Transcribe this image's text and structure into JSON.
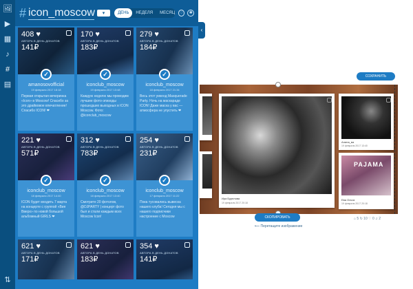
{
  "header": {
    "hash": "#",
    "hashtag": "icon_moscow",
    "dropdown": "▾",
    "periods": [
      "ДЕНЬ",
      "НЕДЕЛЯ",
      "МЕСЯЦ"
    ],
    "active_period": 0
  },
  "rail": [
    "🖼",
    "▶",
    "▦",
    "♪",
    "#",
    "▤",
    "⇅"
  ],
  "cards": [
    {
      "likes": "408 ♥",
      "sub": "АВТОРА В ДЕНЬ ДОНАТОВ",
      "price": "141₽",
      "user": "amanosovofficial",
      "date": "19 февраля 2017 18:18",
      "text": "Первая открытая вечеринка «Icon» в Moscow! Спасибо за это драйвовое впечатление! Спасибо ICON! ❤"
    },
    {
      "likes": "170 ♥",
      "sub": "АВТОРА В ДЕНЬ ДОНАТОВ",
      "price": "183₽",
      "user": "iconclub_moscow",
      "date": "19 февраля 2017 13:48",
      "text": "Каждую неделю мы проводим лучшие фото-эпизоды прошедших выходных в ICON Moscow. Фото: @iconclub_moscow"
    },
    {
      "likes": "279 ♥",
      "sub": "АВТОРА В ДЕНЬ ДОНАТОВ",
      "price": "184₽",
      "user": "iconclub_moscow",
      "date": "18 февраля 2017 21:34",
      "text": "Весь этот уикенд Masquerade Party. Ночь на маскараде ICON! Даже маска у вас — атмосфера не упустить ❤"
    },
    {
      "likes": "221 ♥",
      "sub": "АВТОРА В ДЕНЬ ДОНАТОВ",
      "price": "571₽",
      "user": "iconclub_moscow",
      "date": "18 февраля 2017 14:40",
      "text": "ICON будет входить 7 марта на концерте с группой «Вия Вверх» по новой большой альбомный GIRLS ❤"
    },
    {
      "likes": "312 ♥",
      "sub": "АВТОРА В ДЕНЬ ДОНАТОВ",
      "price": "783₽",
      "user": "iconclub_moscow",
      "date": "18 февраля 2017 13:40",
      "text": "Смотрите 20 фотолов, @DJPARTY | концерт фото был и стали каждым всех Moscow Icon!"
    },
    {
      "likes": "254 ♥",
      "sub": "АВТОРА В ДЕНЬ ДОНАТОВ",
      "price": "231₽",
      "user": "iconclub_moscow",
      "date": "17 февраля 2017 11:22",
      "text": "Пока тусовались вывеска нашего клуба! Сегодня мы с нашего подписчики настроение с Moscow"
    },
    {
      "likes": "621 ♥",
      "sub": "АВТОРА В ДЕНЬ ДОНАТОВ",
      "price": "171₽"
    },
    {
      "likes": "621 ♥",
      "sub": "АВТОРА В ДЕНЬ ДОНАТОВ",
      "price": "183₽"
    },
    {
      "likes": "354 ♥",
      "sub": "АВТОРА В ДЕНЬ ДОНАТОВ",
      "price": "141₽"
    }
  ],
  "editor": {
    "save_label": "СОХРАНИТЬ",
    "copy_label": "СКОПИРОВАТЬ",
    "hint": "⟵ Перетащите изображение",
    "main_photo": {
      "user": "Ира Бурелова",
      "date": "19 февраля 2017 20:18"
    },
    "right_top": {
      "user": "Алина_ва",
      "date": "19 февраля 2017 13:40"
    },
    "right_bottom": {
      "user": "Ева Ольга",
      "date": "19 февраля 2017 20:18",
      "logo": "PAJAMA"
    },
    "footer_counts": "⌂ 5 ↻ 10 ♡ 0 ♫ 2"
  }
}
